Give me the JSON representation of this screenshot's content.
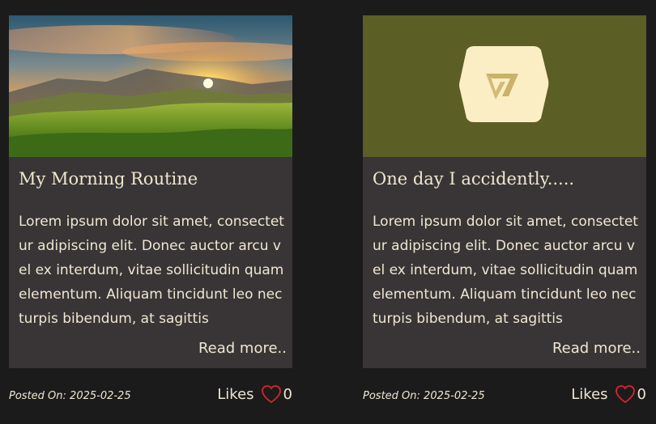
{
  "posts": [
    {
      "title": "My Morning Routine",
      "excerpt": "Lorem ipsum dolor sit amet, consectetur adipiscing elit. Donec auctor arcu vel ex interdum, vitae sollicitudin quam elementum. Aliquam tincidunt leo nec turpis bibendum, at sagittis",
      "read_more": "Read more..",
      "posted_label": "Posted On:",
      "posted_date": "2025-02-25",
      "likes_label": "Likes",
      "likes_count": "0",
      "image": "mountain-sunrise-image"
    },
    {
      "title": "One day I accidently.....",
      "excerpt": "Lorem ipsum dolor sit amet, consectetur adipiscing elit. Donec auctor arcu vel ex interdum, vitae sollicitudin quam elementum. Aliquam tincidunt leo nec turpis bibendum, at sagittis",
      "read_more": "Read more..",
      "posted_label": "Posted On:",
      "posted_date": "2025-02-25",
      "likes_label": "Likes",
      "likes_count": "0",
      "image": "hexagon-logo-placeholder"
    }
  ],
  "colors": {
    "page_bg": "#1b1b1c",
    "card_bg": "#393536",
    "placeholder_bg": "#5b5e25",
    "heart": "#d8242a",
    "text": "#efe6d3"
  }
}
